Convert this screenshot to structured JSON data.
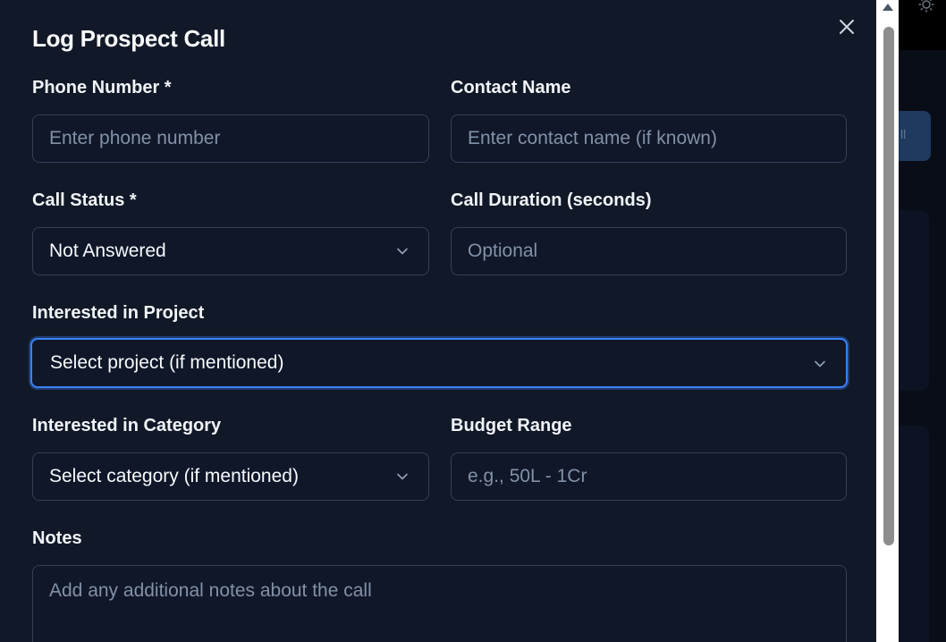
{
  "modal": {
    "title": "Log Prospect Call",
    "close_label": "×"
  },
  "fields": {
    "phone": {
      "label": "Phone Number *",
      "placeholder": "Enter phone number"
    },
    "contact": {
      "label": "Contact Name",
      "placeholder": "Enter contact name (if known)"
    },
    "status": {
      "label": "Call Status *",
      "value": "Not Answered"
    },
    "duration": {
      "label": "Call Duration (seconds)",
      "placeholder": "Optional"
    },
    "project": {
      "label": "Interested in Project",
      "placeholder": "Select project (if mentioned)"
    },
    "category": {
      "label": "Interested in Category",
      "placeholder": "Select category (if mentioned)"
    },
    "budget": {
      "label": "Budget Range",
      "placeholder": "e.g., 50L - 1Cr"
    },
    "notes": {
      "label": "Notes",
      "placeholder": "Add any additional notes about the call"
    }
  },
  "icons": {
    "close": "close-icon",
    "chevron": "chevron-down-icon",
    "theme": "sun-icon"
  },
  "colors": {
    "modal_bg": "#111827",
    "input_bg": "#0f1729",
    "border": "#334155",
    "focus": "#3b82f6"
  }
}
